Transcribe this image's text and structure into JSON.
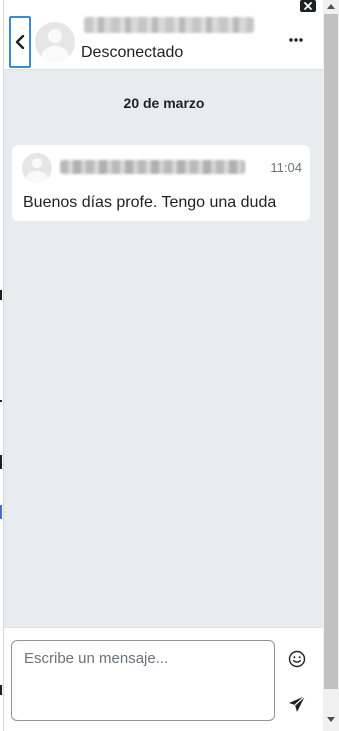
{
  "header": {
    "back_icon": "chevron-left-icon",
    "contact_status": "Desconectado",
    "more_icon": "ellipsis-icon",
    "close_icon": "close-icon"
  },
  "conversation": {
    "date_label": "20 de marzo",
    "messages": [
      {
        "time": "11:04",
        "text": "Buenos días profe. Tengo una duda"
      }
    ]
  },
  "composer": {
    "placeholder": "Escribe un mensaje...",
    "value": "",
    "emoji_icon": "smiley-icon",
    "send_icon": "paper-plane-icon"
  },
  "colors": {
    "accent_focus": "#3b8ad6",
    "drawer_bg": "#e9ecef",
    "text": "#1d2125",
    "muted_text": "#6a737b"
  }
}
